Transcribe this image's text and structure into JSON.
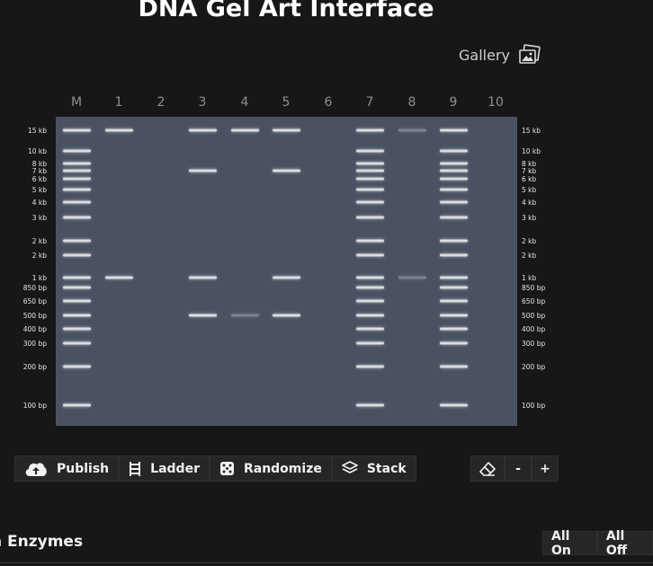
{
  "header": {
    "title": "DNA Gel Art Interface",
    "gallery_label": "Gallery"
  },
  "lanes": [
    "M",
    "1",
    "2",
    "3",
    "4",
    "5",
    "6",
    "7",
    "8",
    "9",
    "10"
  ],
  "ladder_sizes": [
    "15 kb",
    "10 kb",
    "8 kb",
    "7 kb",
    "6 kb",
    "5 kb",
    "4 kb",
    "3 kb",
    "2 kb",
    "2 kb",
    "1 kb",
    "850 bp",
    "650 bp",
    "500 bp",
    "400 bp",
    "300 bp",
    "200 bp",
    "100 bp"
  ],
  "gel_bands": [
    {
      "lane": 1,
      "sizes": [
        0,
        10
      ]
    },
    {
      "lane": 3,
      "sizes": [
        0,
        3,
        10,
        13
      ]
    },
    {
      "lane": 4,
      "sizes": [
        0,
        13
      ]
    },
    {
      "lane": 5,
      "sizes": [
        0,
        3,
        10,
        13
      ]
    },
    {
      "lane": 7,
      "ladder": true
    },
    {
      "lane": 8,
      "sizes": [
        0,
        10
      ]
    },
    {
      "lane": 9,
      "ladder": true
    }
  ],
  "faint_bands": [
    {
      "lane": 4,
      "size": 13
    },
    {
      "lane": 8,
      "size": 0
    },
    {
      "lane": 8,
      "size": 10
    }
  ],
  "toolbar": {
    "publish": "Publish",
    "ladder": "Ladder",
    "randomize": "Randomize",
    "stack": "Stack",
    "minus": "-",
    "plus": "+"
  },
  "enzymes": {
    "title": "n Enzymes",
    "all_on": "All On",
    "all_off": "All Off"
  },
  "colors": {
    "background": "#171717",
    "gel": "#4a5262",
    "band": "#ffffff"
  }
}
